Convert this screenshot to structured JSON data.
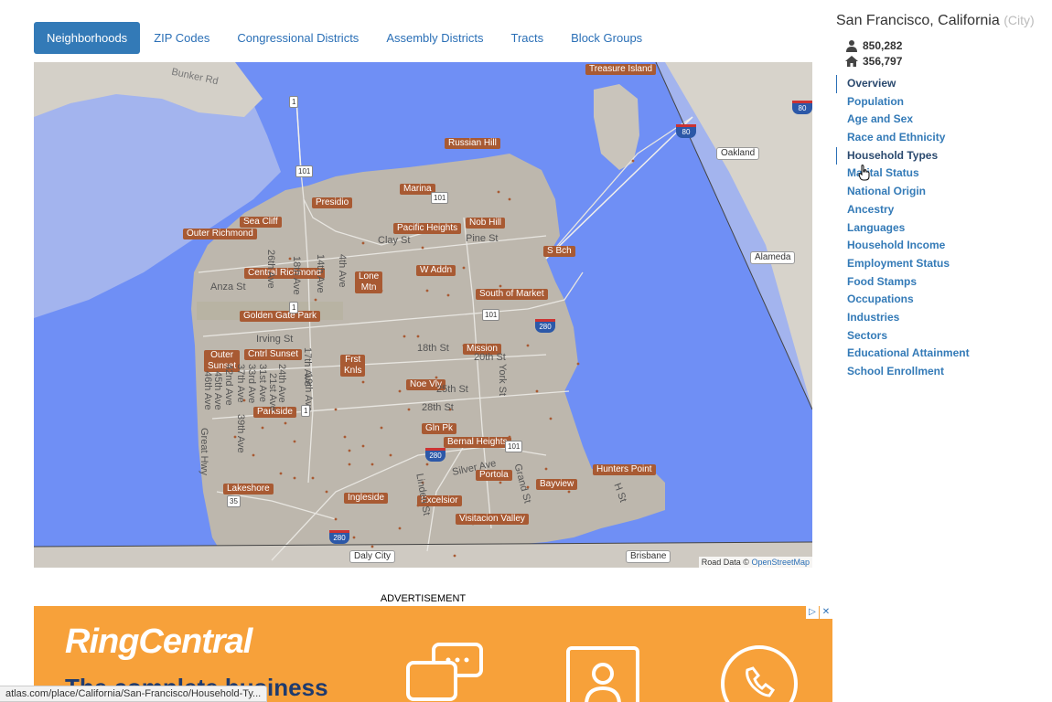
{
  "tabs": [
    "Neighborhoods",
    "ZIP Codes",
    "Congressional Districts",
    "Assembly Districts",
    "Tracts",
    "Block Groups"
  ],
  "map": {
    "neighborhoods": {
      "treasure_island": "Treasure Island",
      "russian_hill": "Russian Hill",
      "marina": "Marina",
      "presidio": "Presidio",
      "sea_cliff": "Sea Cliff",
      "outer_richmond": "Outer Richmond",
      "pacific_heights": "Pacific Heights",
      "nob_hill": "Nob Hill",
      "s_bch": "S Bch",
      "central_richmond": "Central Richmond",
      "lone_mtn_1": "Lone",
      "lone_mtn_2": "Mtn",
      "w_addn": "W Addn",
      "south_of_market": "South of Market",
      "golden_gate_park": "Golden Gate Park",
      "outer_sunset_1": "Outer",
      "outer_sunset_2": "Sunset",
      "cntrl_sunset": "Cntrl Sunset",
      "frst_knls_1": "Frst",
      "frst_knls_2": "Knls",
      "mission": "Mission",
      "noe_vly": "Noe Vly",
      "parkside": "Parkside",
      "gln_pk": "Gln Pk",
      "bernal_heights": "Bernal Heights",
      "hunters_point": "Hunters Point",
      "portola": "Portola",
      "bayview": "Bayview",
      "lakeshore": "Lakeshore",
      "ingleside": "Ingleside",
      "excelsior": "Excelsior",
      "visitacion_valley": "Visitacion Valley"
    },
    "places": {
      "oakland": "Oakland",
      "alameda": "Alameda",
      "daly_city": "Daly City",
      "brisbane": "Brisbane"
    },
    "streets": {
      "bunker_rd": "Bunker Rd",
      "clay_st": "Clay St",
      "pine_st": "Pine St",
      "anza_st": "Anza St",
      "irving_st": "Irving St",
      "st_18th": "18th St",
      "st_20th": "20th St",
      "st_25th": "25th St",
      "st_28th": "28th St",
      "silver_ave": "Silver Ave",
      "york_st": "York St",
      "h_st": "H St",
      "grand_st": "Grand St",
      "linden_st": "Linden St",
      "ave_18th": "18th Ave",
      "ave_26th": "26th Ave",
      "ave_4th": "4th Ave",
      "ave_14th": "14th Ave",
      "ave_17th": "17th Ave",
      "ave_24th": "24th Ave",
      "ave_19th": "19th Ave",
      "ave_39th": "39th Ave",
      "ave_31st": "31st Ave",
      "ave_33rd": "33rd Ave",
      "ave_37th": "37th Ave",
      "ave_42nd": "42nd Ave",
      "ave_45th": "45th Ave",
      "ave_46th": "46th Ave",
      "great_hwy": "Great Hwy",
      "ave_21st": "21st Ave"
    },
    "shields": {
      "us101_a": "101",
      "us101_b": "101",
      "us101_c": "101",
      "us101_d": "101",
      "ca1_a": "1",
      "ca1_b": "1",
      "ca1_c": "1",
      "ca35": "35",
      "i80_a": "80",
      "i80_b": "80",
      "i280_a": "280",
      "i280_b": "280",
      "i280_c": "280"
    },
    "attribution_text": "Road Data ©",
    "attribution_link": "OpenStreetMap"
  },
  "sidebar": {
    "title": "San Francisco, California",
    "title_type": "(City)",
    "population": "850,282",
    "households": "356,797",
    "nav": [
      "Overview",
      "Population",
      "Age and Sex",
      "Race and Ethnicity",
      "Household Types",
      "Marital Status",
      "National Origin",
      "Ancestry",
      "Languages",
      "Household Income",
      "Employment Status",
      "Food Stamps",
      "Occupations",
      "Industries",
      "Sectors",
      "Educational Attainment",
      "School Enrollment"
    ]
  },
  "ad": {
    "label": "ADVERTISEMENT",
    "brand": "RingCentral",
    "tagline": "The complete business"
  },
  "status_url": "atlas.com/place/California/San-Francisco/Household-Ty...",
  "colors": {
    "accent": "#337ab7",
    "water": "#6f8ff5",
    "land": "#bdb7ad",
    "label": "#a85a33",
    "ad_bg": "#f7a13a"
  }
}
